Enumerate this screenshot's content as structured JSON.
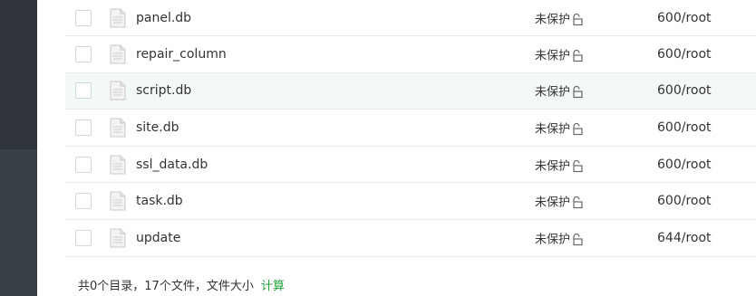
{
  "files": [
    {
      "name": "panel.db",
      "protect": "未保护",
      "perm": "600/root",
      "icon": "file-icon"
    },
    {
      "name": "repair_column",
      "protect": "未保护",
      "perm": "600/root",
      "icon": "file-icon"
    },
    {
      "name": "script.db",
      "protect": "未保护",
      "perm": "600/root",
      "icon": "file-icon"
    },
    {
      "name": "site.db",
      "protect": "未保护",
      "perm": "600/root",
      "icon": "file-icon"
    },
    {
      "name": "ssl_data.db",
      "protect": "未保护",
      "perm": "600/root",
      "icon": "file-icon"
    },
    {
      "name": "task.db",
      "protect": "未保护",
      "perm": "600/root",
      "icon": "file-icon"
    },
    {
      "name": "update",
      "protect": "未保护",
      "perm": "644/root",
      "icon": "file-icon"
    }
  ],
  "footer": {
    "summary": "共0个目录，17个文件，文件大小",
    "calc_label": "计算"
  },
  "colors": {
    "accent": "#20a53a",
    "sidebar": "#3a4047",
    "row_hover": "#f2f9f6"
  }
}
